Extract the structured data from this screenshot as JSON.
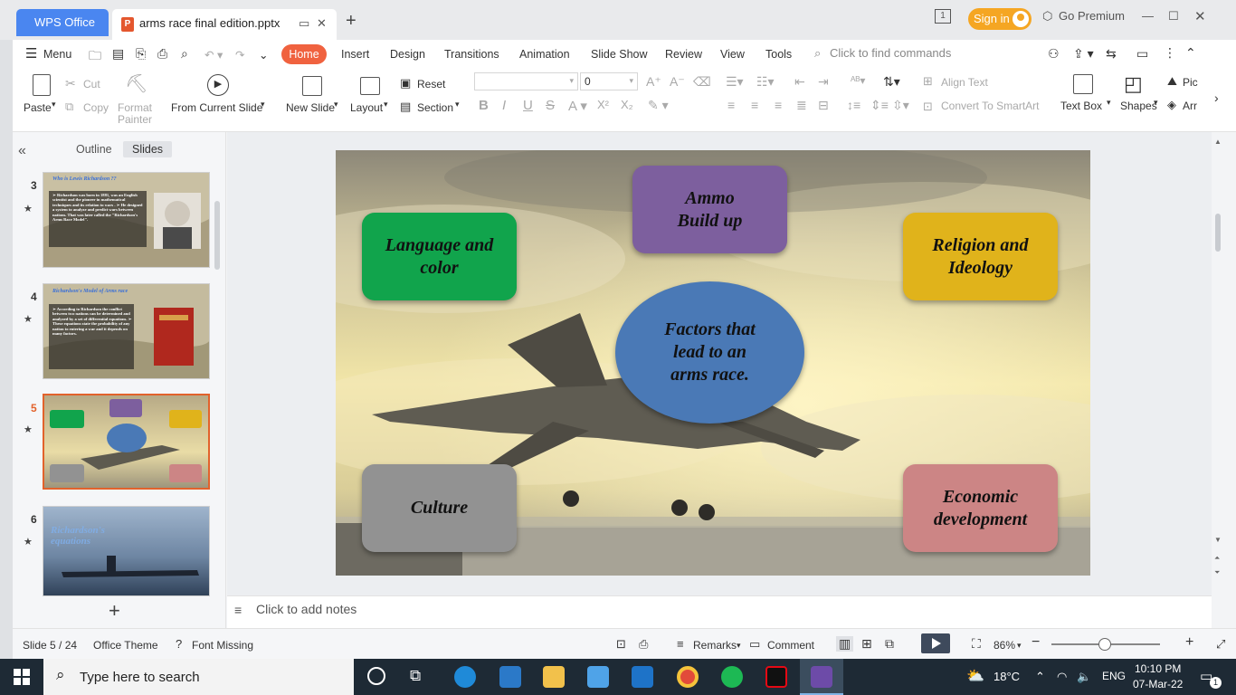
{
  "titlebar": {
    "wps_tab": "WPS Office",
    "doc_tab": "arms race final edition.pptx",
    "sign_in": "Sign in",
    "go_premium": "Go Premium"
  },
  "menu": {
    "menu_label": "Menu",
    "tabs": [
      "Home",
      "Insert",
      "Design",
      "Transitions",
      "Animation",
      "Slide Show",
      "Review",
      "View",
      "Tools"
    ],
    "find_placeholder": "Click to find commands"
  },
  "ribbon": {
    "paste": "Paste",
    "cut": "Cut",
    "copy": "Copy",
    "format_painter_1": "Format",
    "format_painter_2": "Painter",
    "from_current_slide": "From Current Slide",
    "new_slide": "New Slide",
    "layout": "Layout",
    "reset": "Reset",
    "section": "Section",
    "font_size": "0",
    "align_text": "Align Text",
    "convert_smartart": "Convert To SmartArt",
    "text_box": "Text Box",
    "shapes": "Shapes",
    "picture": "Pic",
    "arrange": "Arr"
  },
  "left_panel": {
    "outline_tab": "Outline",
    "slides_tab": "Slides",
    "slide_numbers": [
      "3",
      "4",
      "5",
      "6"
    ],
    "current_slide": "5",
    "thumb3_title": "Who is Lewis Richardson ??",
    "thumb3_bullets": "➢ Richardson was born in 1881, was an English scientist and the pioneer in mathematical techniques and its relation to wars . ➢ He designed a system to analyze and predict wars between nations. That was later called the \"Richardson's Arms Race Model\".",
    "thumb4_title": "Richardson's Model of Arms race",
    "thumb4_bullets": "➢ According to Richardson the conflict between two nations can be determined and analyzed by a set of differential equations. ➢ These equations state the probability of any nation to entering a war and it depends on many factors.",
    "thumb6_title": "Richardson's equations"
  },
  "slide": {
    "center": "Factors that lead to an arms race.",
    "ammo": "Ammo Build up",
    "language": "Language and color",
    "religion": "Religion and Ideology",
    "culture": "Culture",
    "economic": "Economic development",
    "colors": {
      "language": "#11a44c",
      "ammo": "#7d5f9e",
      "religion": "#e0b31b",
      "culture": "#929292",
      "economic": "#cc8585",
      "center": "#4a79b6"
    }
  },
  "notes": {
    "placeholder": "Click to add notes"
  },
  "status": {
    "slide_info": "Slide 5 / 24",
    "theme": "Office Theme",
    "font_missing": "Font Missing",
    "remarks": "Remarks",
    "comment": "Comment",
    "zoom": "86%"
  },
  "taskbar": {
    "search_placeholder": "Type here to search",
    "temperature": "18°C",
    "language": "ENG",
    "time": "10:10 PM",
    "date": "07-Mar-22",
    "notification_count": "1"
  }
}
